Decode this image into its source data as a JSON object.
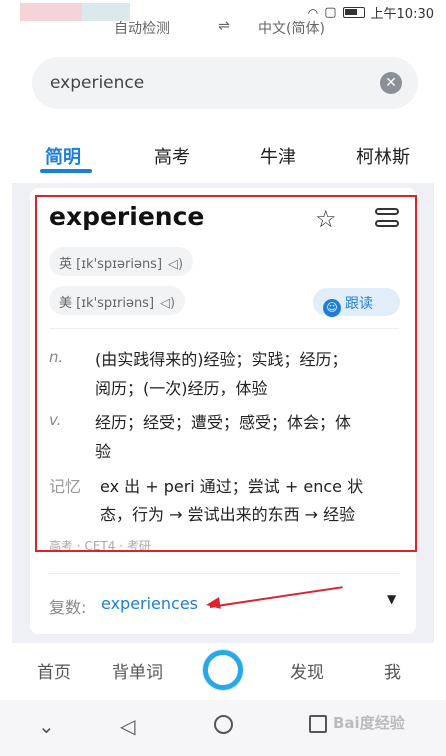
{
  "status_bar": {
    "time": "上午10:30"
  },
  "header": {
    "left": "自动检测",
    "arrow": "⇌",
    "right": "中文(简体)"
  },
  "search": {
    "value": "experience"
  },
  "tabs": [
    {
      "label": "简明"
    },
    {
      "label": "高考"
    },
    {
      "label": "牛津"
    },
    {
      "label": "柯林斯"
    }
  ],
  "entry": {
    "word": "experience",
    "pron_uk": "英 [ɪk'spɪəriəns]",
    "pron_us": "美 [ɪk'spɪriəns]",
    "read_label": "跟读",
    "definitions": [
      {
        "pos": "n.",
        "lines": [
          "(由实践得来的)经验；实践；经历；",
          "阅历；(一次)经历，体验"
        ]
      },
      {
        "pos": "v.",
        "lines": [
          "经历；经受；遭受；感受；体会；体",
          "验"
        ]
      }
    ],
    "memory": {
      "label": "记忆",
      "lines": [
        "ex 出 + peri 通过；尝试 + ence 状",
        "态，行为 → 尝试出来的东西 → 经验"
      ]
    },
    "exam": "高考 · CET4 · 考研",
    "plural_label": "复数:",
    "plural_value": "experiences"
  },
  "bottom_nav": [
    {
      "label": "首页"
    },
    {
      "label": "背单词"
    },
    {
      "label": "发现"
    },
    {
      "label": "我"
    }
  ],
  "watermark": "Bai度经验",
  "colors": {
    "accent": "#1e7fd6",
    "annotation": "#d9232d",
    "assistant_ring": "#29a8e6"
  }
}
